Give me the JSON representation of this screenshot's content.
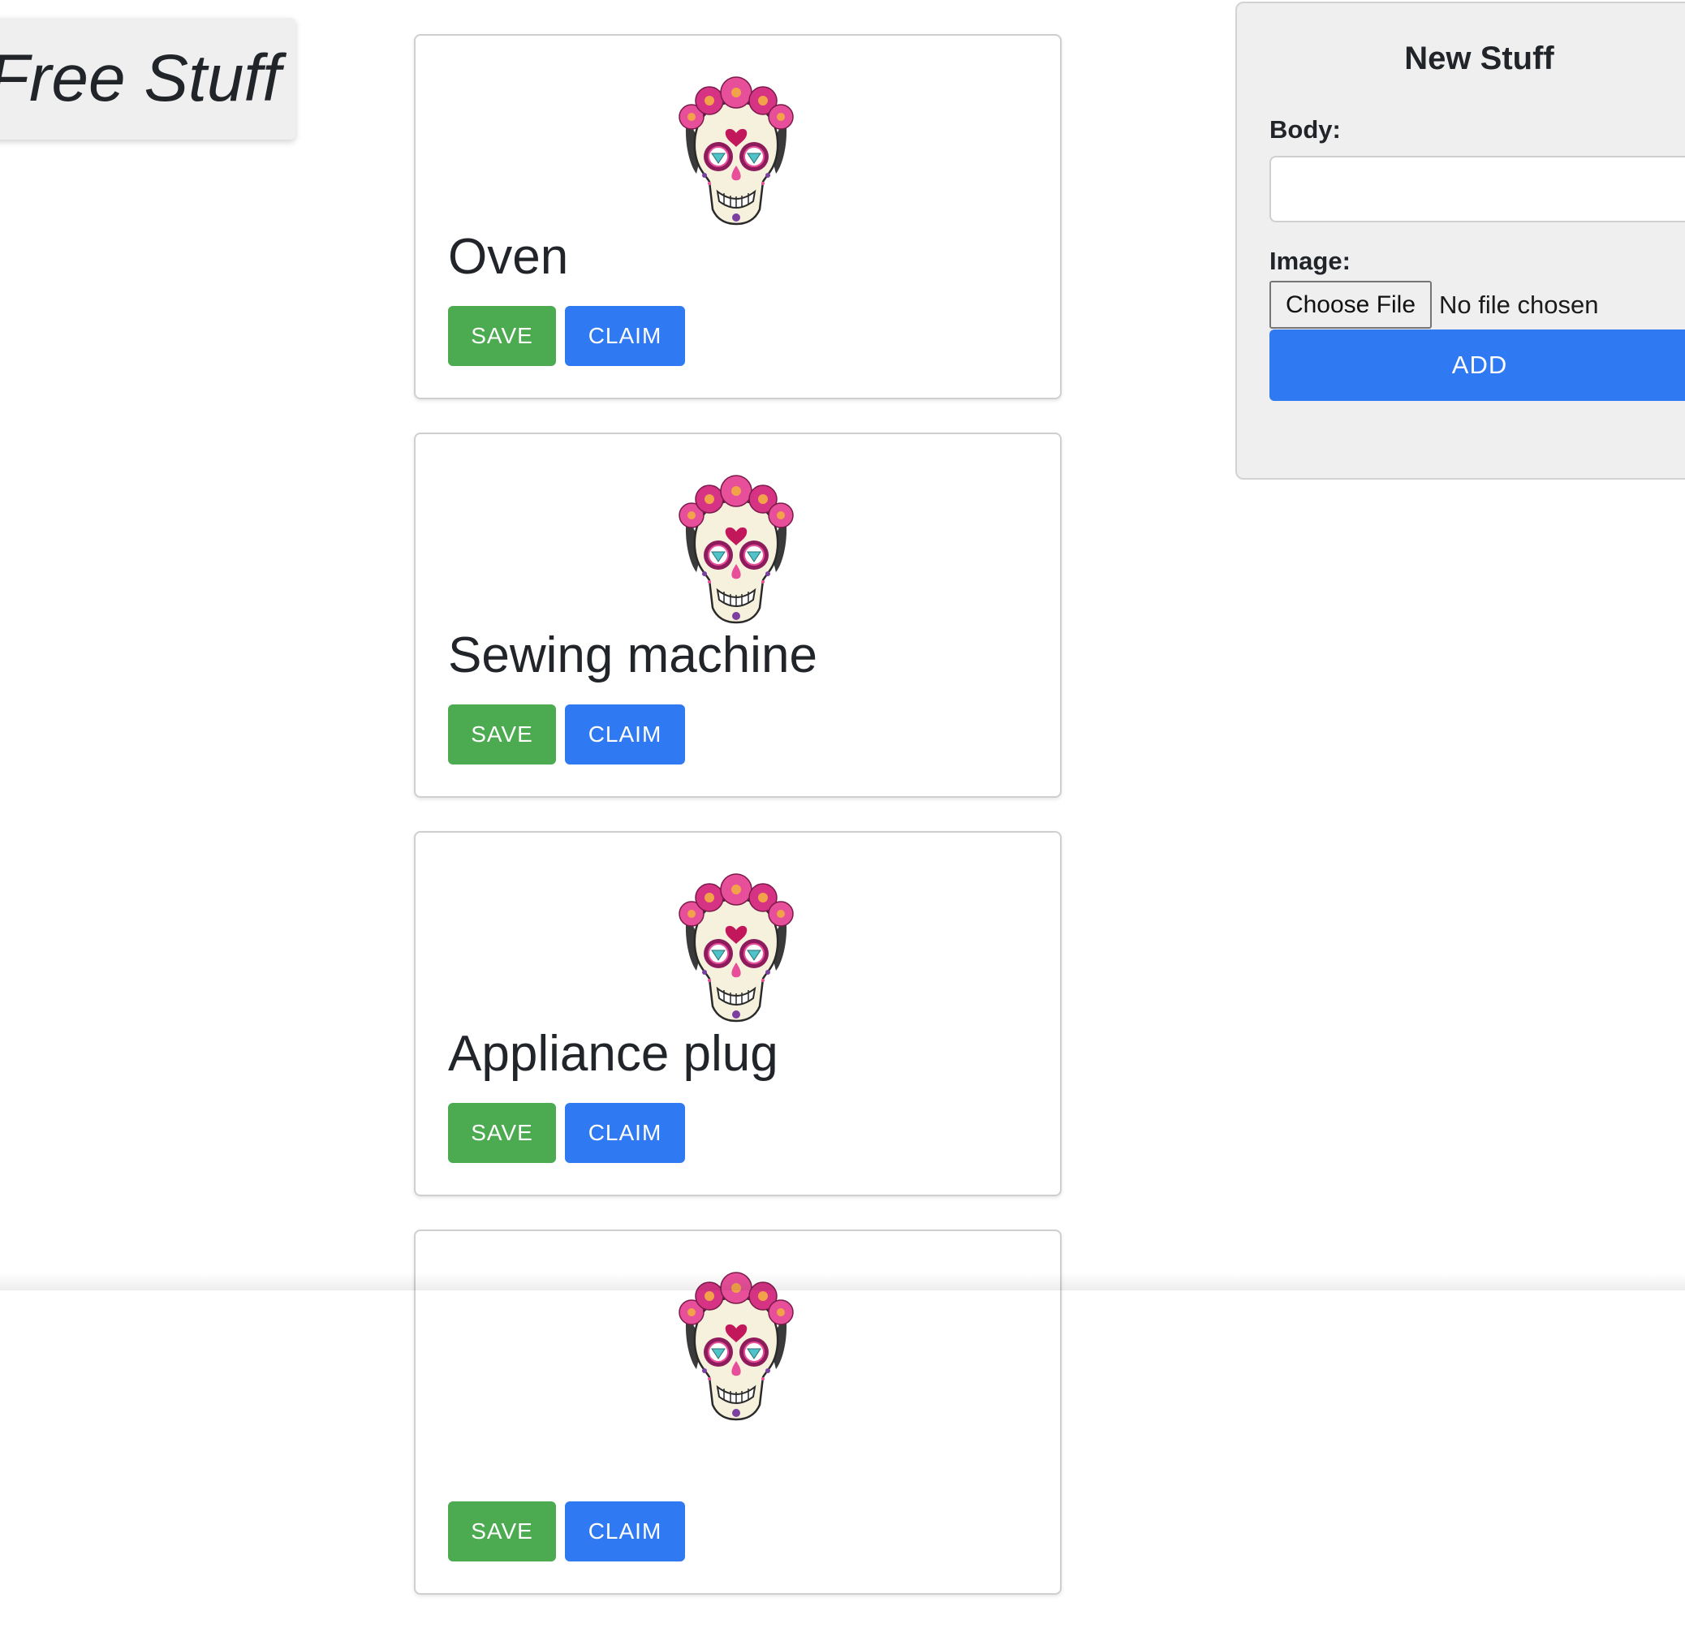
{
  "brand": {
    "title": "Free Stuff"
  },
  "feed": {
    "items": [
      {
        "title": "Oven",
        "save_label": "SAVE",
        "claim_label": "CLAIM"
      },
      {
        "title": "Sewing machine",
        "save_label": "SAVE",
        "claim_label": "CLAIM"
      },
      {
        "title": "Appliance plug",
        "save_label": "SAVE",
        "claim_label": "CLAIM"
      },
      {
        "title": "",
        "save_label": "SAVE",
        "claim_label": "CLAIM"
      }
    ]
  },
  "form": {
    "title": "New Stuff",
    "body_label": "Body:",
    "body_value": "",
    "image_label": "Image:",
    "choose_file_label": "Choose File",
    "file_status": "No file chosen",
    "add_label": "ADD"
  },
  "colors": {
    "save_button": "#4caa50",
    "primary_button": "#2f7af2",
    "panel_background": "#efefef"
  },
  "icons": {
    "item_image": "sugar-skull-icon"
  }
}
